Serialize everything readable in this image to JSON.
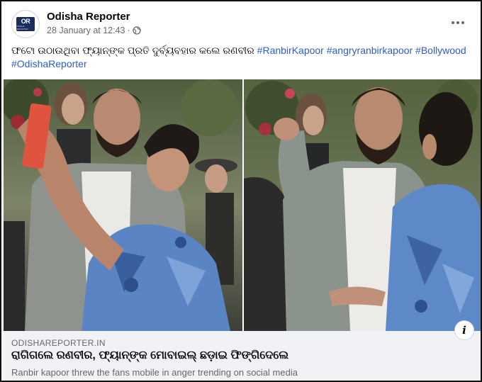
{
  "post": {
    "page_name": "Odisha Reporter",
    "date": "28 January at 12:43",
    "date_separator": "·",
    "logo_mark": "OR",
    "logo_sub": "ODISHA REPORTER",
    "caption_text": "ଫଟୋ ଉଠାଉଥିବା ଫ୍ୟାନ୍‌ଙ୍କ ପ୍ରତି ଦୁର୍ବ୍ୟବହାର କଲେ ରଣବୀର",
    "hashtags": [
      "#RanbirKapoor",
      "#angryranbirkapoor",
      "#Bollywood",
      "#OdishaReporter"
    ]
  },
  "link_preview": {
    "domain": "ODISHAREPORTER.IN",
    "title": "ରାଗିଗଲେ ରଣବୀର, ଫ୍ୟାନ୍‌ଙ୍କ ମୋବାଇଲ୍ ଛଡ଼ାଇ ଫିଙ୍ଗିଦେଲେ",
    "description": "Ranbir kapoor threw the fans mobile in anger trending on social media",
    "info_icon": "i"
  },
  "colors": {
    "hashtag": "#2d5ec4",
    "link_bg": "#f0f2f5",
    "meta": "#65676b"
  },
  "icons": {
    "privacy": "globe-icon",
    "menu": "more-options-icon",
    "info": "info-icon"
  }
}
